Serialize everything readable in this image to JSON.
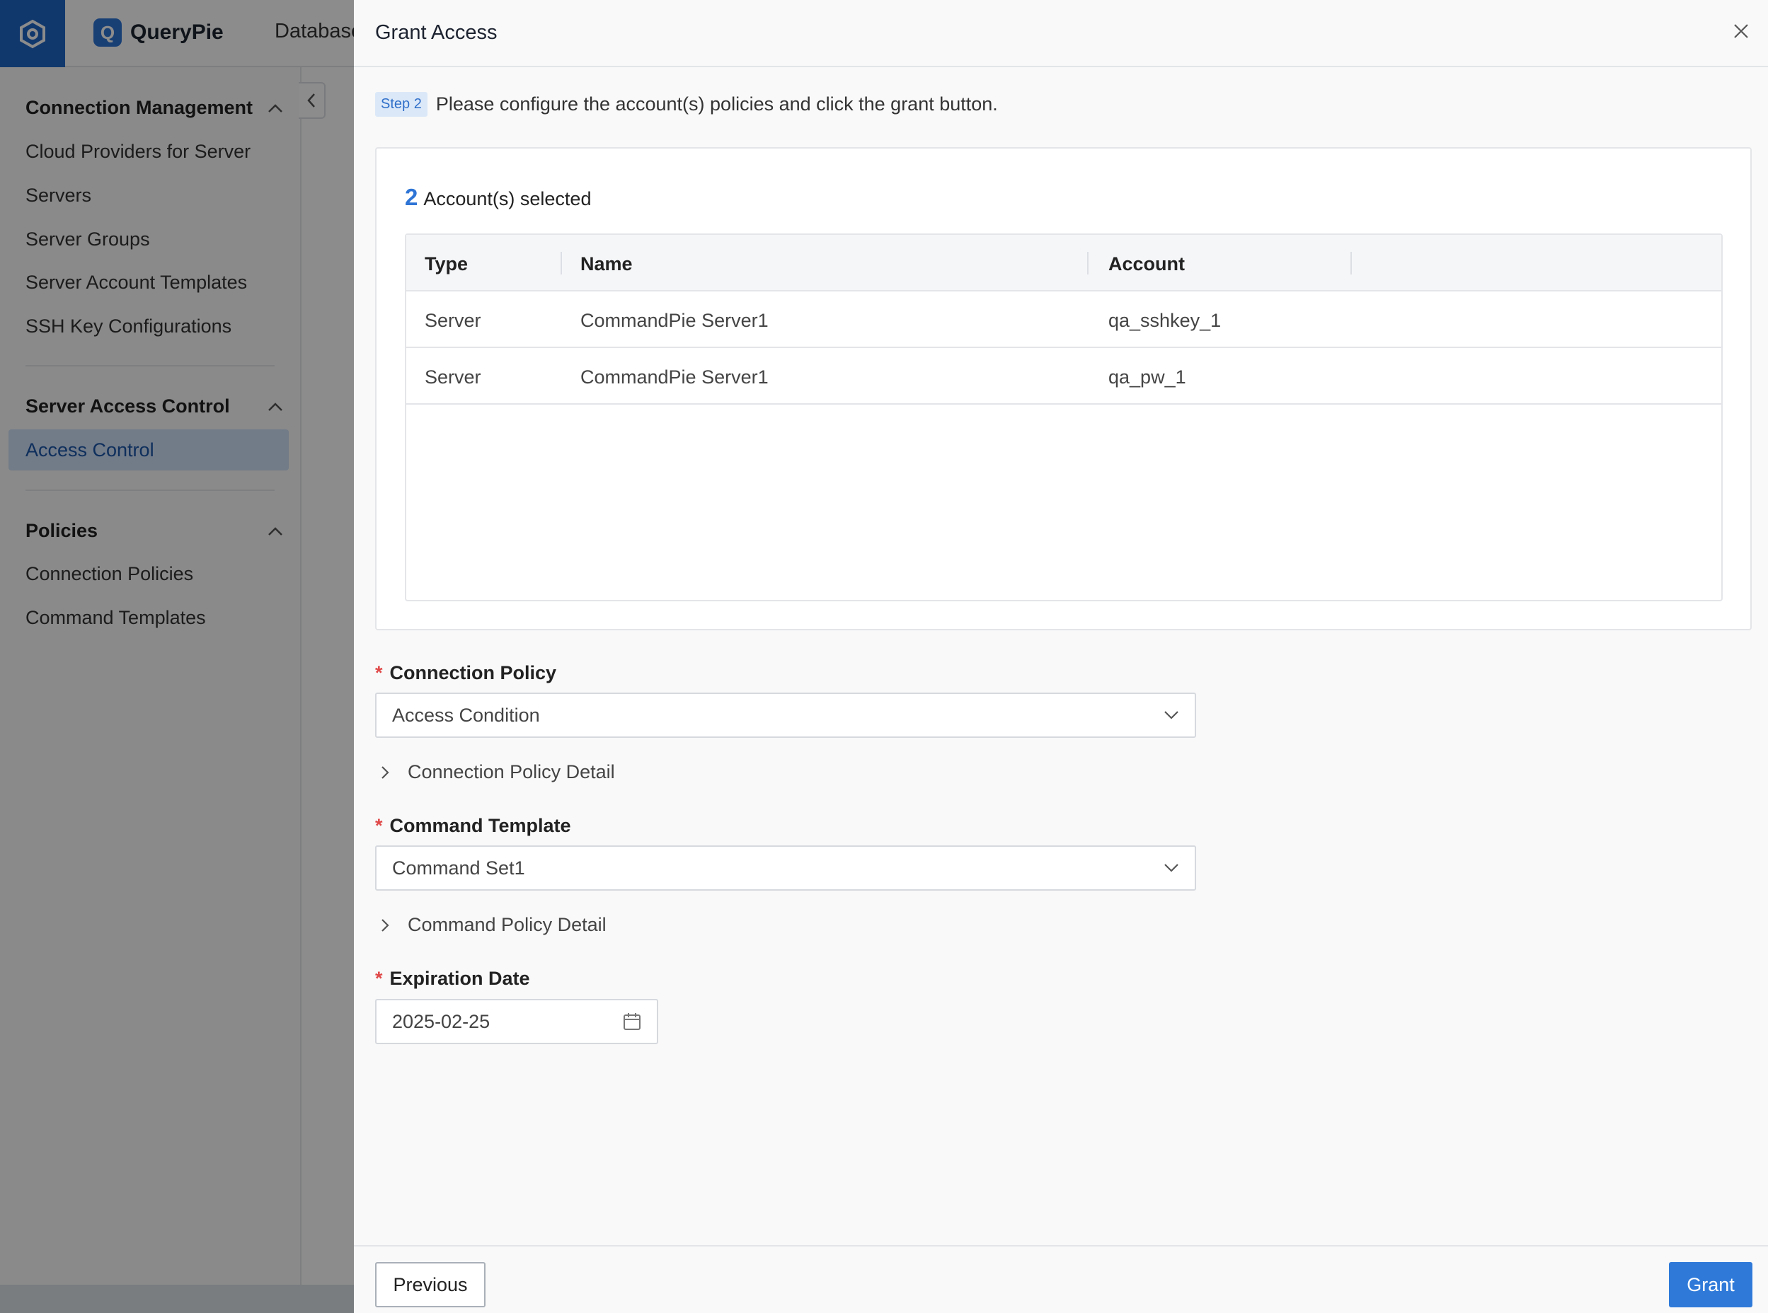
{
  "app": {
    "brand_name": "QueryPie",
    "top_nav_item": "Database",
    "logo_icon": "querypie-logo-icon"
  },
  "sidebar": {
    "sections": [
      {
        "title": "Connection Management",
        "items": [
          "Cloud Providers for Server",
          "Servers",
          "Server Groups",
          "Server Account Templates",
          "SSH Key Configurations"
        ]
      },
      {
        "title": "Server Access Control",
        "items": [
          "Access Control"
        ]
      },
      {
        "title": "Policies",
        "items": [
          "Connection Policies",
          "Command Templates"
        ]
      }
    ],
    "active_item": "Access Control"
  },
  "drawer": {
    "title": "Grant Access",
    "step_badge": "Step 2",
    "step_text": "Please configure the account(s) policies and click the grant button.",
    "selected_count": "2",
    "selected_label": "Account(s) selected",
    "table": {
      "columns": [
        "Type",
        "Name",
        "Account"
      ],
      "rows": [
        [
          "Server",
          "CommandPie Server1",
          "qa_sshkey_1"
        ],
        [
          "Server",
          "CommandPie Server1",
          "qa_pw_1"
        ]
      ]
    },
    "connection_policy": {
      "label": "Connection Policy",
      "value": "Access Condition",
      "detail_label": "Connection Policy Detail"
    },
    "command_template": {
      "label": "Command Template",
      "value": "Command Set1",
      "detail_label": "Command Policy Detail"
    },
    "expiration_date": {
      "label": "Expiration Date",
      "value": "2025-02-25"
    },
    "required_mark": "*",
    "previous_label": "Previous",
    "grant_label": "Grant"
  },
  "colors": {
    "accent": "#2f7ad9",
    "logo_bg": "#1f66c7",
    "required": "#e04848",
    "active_item_bg": "#cfe0f7"
  }
}
